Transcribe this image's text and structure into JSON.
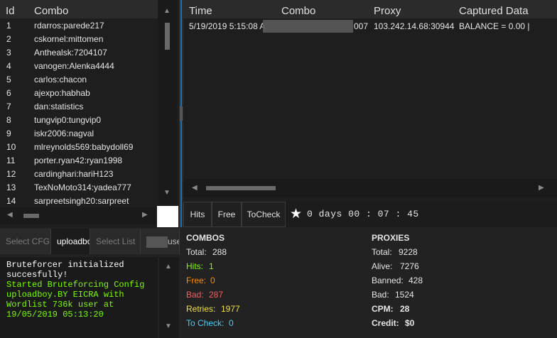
{
  "combo_list": {
    "columns": [
      "Id",
      "Combo"
    ],
    "rows": [
      {
        "id": "1",
        "combo": "rdarros:parede217"
      },
      {
        "id": "2",
        "combo": "cskornel:mittomen"
      },
      {
        "id": "3",
        "combo": "Anthealsk:7204107"
      },
      {
        "id": "4",
        "combo": "vanogen:Alenka4444"
      },
      {
        "id": "5",
        "combo": "carlos:chacon"
      },
      {
        "id": "6",
        "combo": "ajexpo:habhab"
      },
      {
        "id": "7",
        "combo": "dan:statistics"
      },
      {
        "id": "8",
        "combo": "tungvip0:tungvip0"
      },
      {
        "id": "9",
        "combo": "iskr2006:nagval"
      },
      {
        "id": "10",
        "combo": "mlreynolds569:babydoll69"
      },
      {
        "id": "11",
        "combo": "porter.ryan42:ryan1998"
      },
      {
        "id": "12",
        "combo": "cardinghari:hariH123"
      },
      {
        "id": "13",
        "combo": "TexNoMoto314:yadea777"
      },
      {
        "id": "14",
        "combo": "sarpreetsingh20:sarpreet"
      }
    ]
  },
  "captures": {
    "columns": [
      "Time",
      "Combo",
      "Proxy",
      "Captured Data"
    ],
    "rows": [
      {
        "time": "5/19/2019 5:15:08 A",
        "combo": "007",
        "proxy": "103.242.14.68:30944",
        "data": "BALANCE = 0.00 |"
      }
    ]
  },
  "result_tabs": [
    "Hits",
    "Free",
    "ToCheck"
  ],
  "timer": {
    "label": "0  days  00 : 07 : 45"
  },
  "left_tabs": [
    "Select CFG",
    "uploadbo",
    "Select List",
    "user"
  ],
  "console_lines": [
    {
      "text": "Bruteforcer initialized",
      "color": "#ffffff"
    },
    {
      "text": "succesfully!",
      "color": "#ffffff"
    },
    {
      "text": "Started Bruteforcing Config",
      "color": "#7cfc00"
    },
    {
      "text": "uploadboy.BY EICRA with",
      "color": "#7cfc00"
    },
    {
      "text": "Wordlist 736k user at",
      "color": "#7cfc00"
    },
    {
      "text": "19/05/2019 05:13:20",
      "color": "#7cfc00"
    }
  ],
  "combos_stats": {
    "title": "COMBOS",
    "items": [
      {
        "label": "Total:",
        "value": "288",
        "color": "#e6e6e6"
      },
      {
        "label": "Hits:",
        "value": "1",
        "color": "#7cfc00"
      },
      {
        "label": "Free:",
        "value": "0",
        "color": "#ff8c00"
      },
      {
        "label": "Bad:",
        "value": "287",
        "color": "#ff5a5a"
      },
      {
        "label": "Retries:",
        "value": "1977",
        "color": "#f0e040"
      },
      {
        "label": "To Check:",
        "value": "0",
        "color": "#40d0ff"
      }
    ]
  },
  "proxies_stats": {
    "title": "PROXIES",
    "items": [
      {
        "label": "Total:",
        "value": "9228"
      },
      {
        "label": "Alive:",
        "value": "7276"
      },
      {
        "label": "Banned:",
        "value": "428"
      },
      {
        "label": "Bad:",
        "value": "1524"
      },
      {
        "label": "CPM:",
        "value": "28"
      },
      {
        "label": "Credit:",
        "value": "$0"
      }
    ]
  }
}
